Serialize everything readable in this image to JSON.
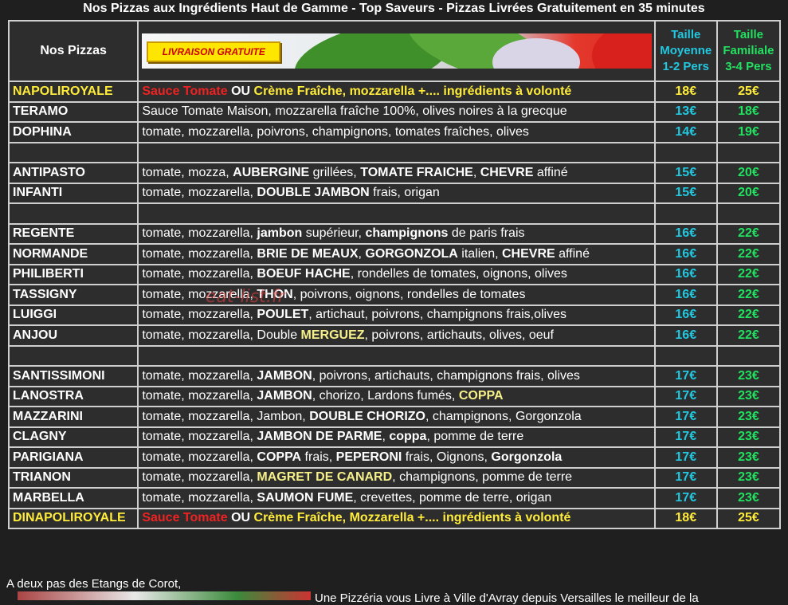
{
  "title": "Nos Pizzas aux Ingrédients Haut de Gamme - Top Saveurs - Pizzas Livrées Gratuitement en 35 minutes",
  "header": {
    "col_name": "Nos Pizzas",
    "banner_badge": "LIVRAISON GRATUITE",
    "col_mid": [
      "Taille",
      "Moyenne",
      "1-2 Pers"
    ],
    "col_fam": [
      "Taille",
      "Familiale",
      "3-4 Pers"
    ]
  },
  "pizzas": [
    {
      "name": "NAPOLIROYALE",
      "desc": [
        [
          "red",
          "Sauce Tomate"
        ],
        [
          "b",
          " OU "
        ],
        [
          "yb",
          "Crème Fraîche, mozzarella +.... ingrédients à volonté"
        ]
      ],
      "mid": "18€",
      "fam": "25€",
      "highlight": true
    },
    {
      "name": "TERAMO",
      "desc": [
        [
          "t",
          "Sauce Tomate Maison, mozzarella fraîche 100%, olives noires à la grecque"
        ]
      ],
      "mid": "13€",
      "fam": "18€"
    },
    {
      "name": "DOPHINA",
      "desc": [
        [
          "t",
          "tomate, mozzarella, poivrons, champignons, tomates fraîches, olives"
        ]
      ],
      "mid": "14€",
      "fam": "19€"
    },
    {
      "spacer": true
    },
    {
      "name": "ANTIPASTO",
      "desc": [
        [
          "t",
          "tomate, mozza,  "
        ],
        [
          "b",
          "AUBERGINE"
        ],
        [
          "t",
          " grillées, "
        ],
        [
          "b",
          "TOMATE FRAICHE"
        ],
        [
          "t",
          ", "
        ],
        [
          "b",
          "CHEVRE"
        ],
        [
          "t",
          " affiné"
        ]
      ],
      "mid": "15€",
      "fam": "20€"
    },
    {
      "name": "INFANTI",
      "desc": [
        [
          "t",
          "tomate, mozzarella,  "
        ],
        [
          "b",
          "DOUBLE JAMBON"
        ],
        [
          "t",
          " frais, origan"
        ]
      ],
      "mid": "15€",
      "fam": "20€"
    },
    {
      "spacer": true
    },
    {
      "name": "REGENTE",
      "desc": [
        [
          "t",
          "tomate, mozzarella,  "
        ],
        [
          "b",
          "jambon"
        ],
        [
          "t",
          " supérieur, "
        ],
        [
          "b",
          "champignons"
        ],
        [
          "t",
          " de paris frais"
        ]
      ],
      "mid": "16€",
      "fam": "22€"
    },
    {
      "name": "NORMANDE",
      "desc": [
        [
          "t",
          "tomate, mozzarella, "
        ],
        [
          "b",
          "BRIE DE MEAUX"
        ],
        [
          "t",
          ", "
        ],
        [
          "b",
          "GORGONZOLA"
        ],
        [
          "t",
          " italien, "
        ],
        [
          "b",
          "CHEVRE"
        ],
        [
          "t",
          " affiné"
        ]
      ],
      "mid": "16€",
      "fam": "22€"
    },
    {
      "name": "PHILIBERTI",
      "desc": [
        [
          "t",
          "tomate, mozzarella, "
        ],
        [
          "b",
          "BOEUF HACHE"
        ],
        [
          "t",
          ", rondelles de tomates, oignons, olives"
        ]
      ],
      "mid": "16€",
      "fam": "22€"
    },
    {
      "name": "TASSIGNY",
      "desc": [
        [
          "t",
          "tomate, mozzarella, "
        ],
        [
          "b",
          "THON"
        ],
        [
          "t",
          ", poivrons, oignons, rondelles de tomates"
        ]
      ],
      "mid": "16€",
      "fam": "22€"
    },
    {
      "name": "LUIGGI",
      "desc": [
        [
          "t",
          "tomate,  mozzarella,  "
        ],
        [
          "b",
          "POULET"
        ],
        [
          "t",
          ",  artichaut,  poivrons,  champignons  frais,olives"
        ]
      ],
      "mid": "16€",
      "fam": "22€"
    },
    {
      "name": "ANJOU",
      "desc": [
        [
          "t",
          "tomate, mozzarella, Double "
        ],
        [
          "y",
          "MERGUEZ"
        ],
        [
          "t",
          ", poivrons, artichauts, olives, oeuf"
        ]
      ],
      "mid": "16€",
      "fam": "22€"
    },
    {
      "spacer": true
    },
    {
      "name": "SANTISSIMONI",
      "desc": [
        [
          "t",
          "tomate, mozzarella, "
        ],
        [
          "b",
          "JAMBON"
        ],
        [
          "t",
          ", poivrons, artichauts, champignons frais, olives"
        ]
      ],
      "mid": "17€",
      "fam": "23€"
    },
    {
      "name": "LANOSTRA",
      "desc": [
        [
          "t",
          "tomate, mozzarella, "
        ],
        [
          "b",
          "JAMBON"
        ],
        [
          "t",
          ", chorizo, Lardons fumés, "
        ],
        [
          "y",
          "COPPA"
        ]
      ],
      "mid": "17€",
      "fam": "23€"
    },
    {
      "name": "MAZZARINI",
      "desc": [
        [
          "t",
          "tomate, mozzarella, Jambon, "
        ],
        [
          "b",
          "DOUBLE CHORIZO"
        ],
        [
          "t",
          ", champignons, Gorgonzola"
        ]
      ],
      "mid": "17€",
      "fam": "23€"
    },
    {
      "name": "CLAGNY",
      "desc": [
        [
          "t",
          "tomate, mozzarella, "
        ],
        [
          "b",
          "JAMBON DE PARME"
        ],
        [
          "t",
          ", "
        ],
        [
          "b",
          "coppa"
        ],
        [
          "t",
          ", pomme de terre"
        ]
      ],
      "mid": "17€",
      "fam": "23€"
    },
    {
      "name": "PARIGIANA",
      "desc": [
        [
          "t",
          "tomate, mozzarella, "
        ],
        [
          "b",
          "COPPA"
        ],
        [
          "t",
          " frais, "
        ],
        [
          "b",
          "PEPERONI"
        ],
        [
          "t",
          " frais, Oignons, "
        ],
        [
          "b",
          "Gorgonzola"
        ]
      ],
      "mid": "17€",
      "fam": "23€"
    },
    {
      "name": "TRIANON",
      "desc": [
        [
          "t",
          "tomate, mozzarella, "
        ],
        [
          "y",
          "MAGRET DE CANARD"
        ],
        [
          "t",
          ", champignons, pomme de terre"
        ]
      ],
      "mid": "17€",
      "fam": "23€"
    },
    {
      "name": "MARBELLA",
      "desc": [
        [
          "t",
          "tomate, mozzarella, "
        ],
        [
          "b",
          "SAUMON FUME"
        ],
        [
          "t",
          ", crevettes, pomme de terre, origan"
        ]
      ],
      "mid": "17€",
      "fam": "23€"
    },
    {
      "name": "DINAPOLIROYALE",
      "desc": [
        [
          "red",
          "Sauce Tomate"
        ],
        [
          "b",
          " OU "
        ],
        [
          "yb",
          "Crème Fraîche, Mozzarella +.... ingrédients à volonté"
        ]
      ],
      "mid": "18€",
      "fam": "25€",
      "highlight": true
    }
  ],
  "watermark": "eat-list.fr",
  "footer": {
    "line1": "A deux pas des Etangs de Corot,",
    "partial": "Une Pizzéria vous Livre à Ville d'Avray depuis Versailles le meilleur de la"
  },
  "colors": {
    "mid_price": "#22c8e0",
    "fam_price": "#22e060",
    "highlight": "#ffec3a",
    "accent_red": "#ee2222"
  }
}
